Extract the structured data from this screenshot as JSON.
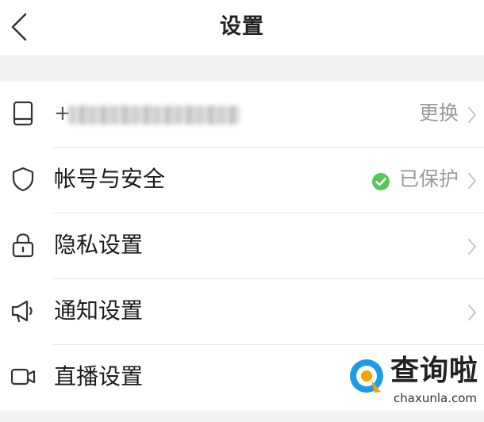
{
  "header": {
    "title": "设置",
    "back_icon": "chevron-left-icon"
  },
  "settings": {
    "rows": [
      {
        "icon": "phone-icon",
        "label": "+",
        "value": "更换",
        "note": "phone number obscured"
      },
      {
        "icon": "shield-icon",
        "label": "帐号与安全",
        "value": "已保护",
        "status_color": "#5ac55a"
      },
      {
        "icon": "lock-icon",
        "label": "隐私设置"
      },
      {
        "icon": "megaphone-icon",
        "label": "通知设置"
      },
      {
        "icon": "video-camera-icon",
        "label": "直播设置"
      }
    ]
  },
  "watermark": {
    "name": "查询啦",
    "url": "chaxunla.com"
  },
  "colors": {
    "background": "#f2f2f2",
    "card": "#ffffff",
    "text": "#1a1a1a",
    "secondary_text": "#9a9a9a",
    "check_green": "#5ac55a",
    "logo_blue": "#1e9be6",
    "logo_orange": "#f5a300"
  }
}
